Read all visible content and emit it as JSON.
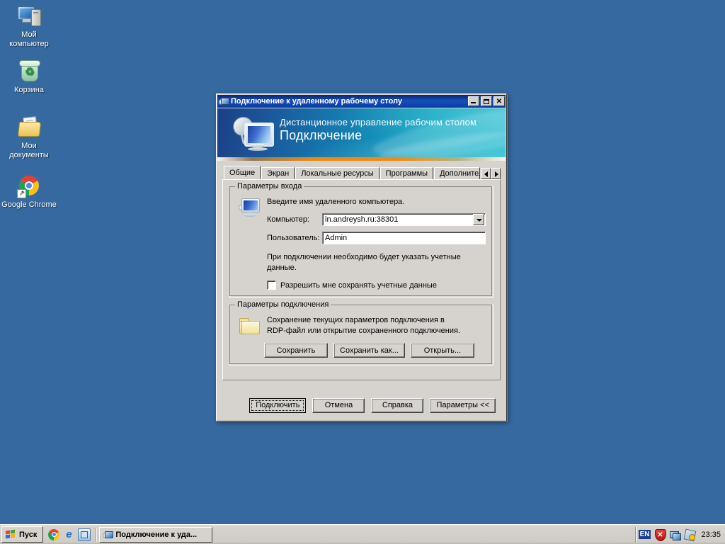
{
  "desktop": {
    "background_color": "#36699f",
    "icons": [
      {
        "name": "my-computer",
        "label": "Мой\nкомпьютер",
        "line1": "Мой",
        "line2": "компьютер"
      },
      {
        "name": "recycle-bin",
        "label": "Корзина",
        "line1": "Корзина",
        "line2": ""
      },
      {
        "name": "my-documents",
        "label": "Мои\nдокументы",
        "line1": "Мои",
        "line2": "документы"
      },
      {
        "name": "google-chrome",
        "label": "Google Chrome",
        "line1": "Google Chrome",
        "line2": ""
      }
    ]
  },
  "dialog": {
    "titlebar": {
      "title": "Подключение к удаленному рабочему столу",
      "icon": "remote-desktop-icon",
      "minimize": "_",
      "maximize": "□",
      "close": "✕"
    },
    "banner": {
      "subtitle": "Дистанционное управление рабочим столом",
      "title": "Подключение",
      "icon": "remote-desktop-banner-icon",
      "gradient_start": "#1d3f86",
      "gradient_end": "#25bcd0",
      "stripe_color": "#f38a10"
    },
    "tabs": [
      {
        "label": "Общие",
        "active": true
      },
      {
        "label": "Экран",
        "active": false
      },
      {
        "label": "Локальные ресурсы",
        "active": false
      },
      {
        "label": "Программы",
        "active": false
      },
      {
        "label": "Дополнительно",
        "active": false
      }
    ],
    "tab_scroll": {
      "left": "◄",
      "right": "►"
    },
    "logon_group": {
      "legend": "Параметры входа",
      "hint": "Введите имя удаленного компьютера.",
      "computer_label": "Компьютер:",
      "computer_value": "in.andreysh.ru:38301",
      "user_label": "Пользователь:",
      "user_value": "Admin",
      "credentials_note_line1": "При подключении необходимо будет указать учетные",
      "credentials_note_line2": "данные.",
      "save_credentials_checkbox": "Разрешить мне сохранять учетные данные",
      "save_credentials_checked": false
    },
    "connection_group": {
      "legend": "Параметры подключения",
      "hint_line1": "Сохранение текущих параметров подключения в",
      "hint_line2": "RDP-файл или открытие сохраненного подключения.",
      "buttons": [
        {
          "label": "Сохранить"
        },
        {
          "label": "Сохранить как..."
        },
        {
          "label": "Открыть..."
        }
      ]
    },
    "footer_buttons": [
      {
        "label": "Подключить",
        "default": true
      },
      {
        "label": "Отмена",
        "default": false
      },
      {
        "label": "Справка",
        "default": false
      },
      {
        "label": "Параметры <<",
        "default": false
      }
    ]
  },
  "taskbar": {
    "start_label": "Пуск",
    "quick_launch": [
      {
        "name": "chrome-icon"
      },
      {
        "name": "internet-explorer-icon",
        "glyph": "e"
      },
      {
        "name": "show-desktop-icon"
      }
    ],
    "task_buttons": [
      {
        "label": "Подключение к уда...",
        "icon": "remote-desktop-icon",
        "active": true
      }
    ],
    "tray": {
      "language": "EN",
      "icons": [
        {
          "name": "security-shield-alert-icon",
          "glyph": "✕"
        },
        {
          "name": "network-connection-icon"
        },
        {
          "name": "update-package-icon"
        }
      ],
      "clock": "23:35"
    }
  }
}
